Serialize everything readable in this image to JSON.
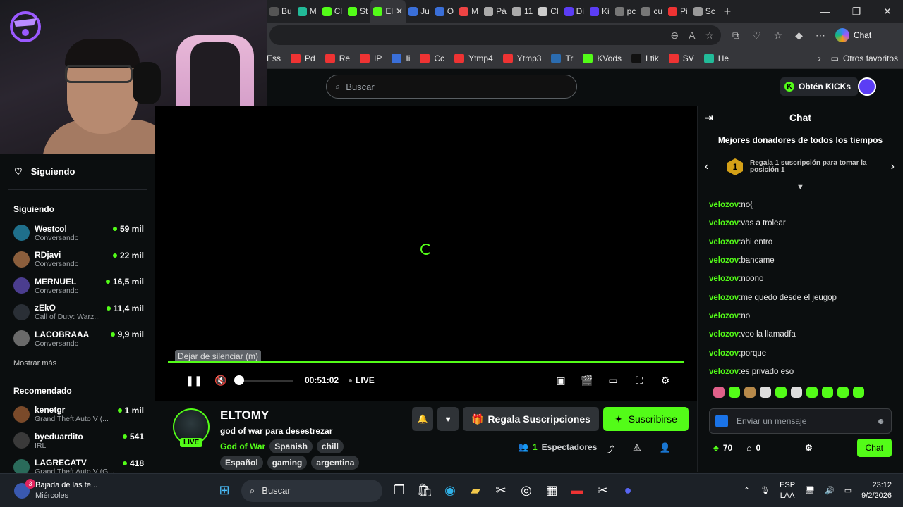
{
  "browser": {
    "tabs": [
      "Bu",
      "M",
      "Cl",
      "St",
      "El",
      "Ju",
      "O",
      "M",
      "Pá",
      "11",
      "Cl",
      "Di",
      "Ki",
      "pc",
      "cu",
      "Pi",
      "Sc"
    ],
    "active_tab_index": 4,
    "copilot_label": "Chat",
    "bookmarks": [
      "Pd",
      "Re",
      "IP",
      "Ii",
      "Cc",
      "Ytmp4",
      "Ytmp3",
      "Tr",
      "KVods",
      "Ltik",
      "SV",
      "He"
    ],
    "bookmark_first_partial": "Ess",
    "other_favorites": "Otros favoritos"
  },
  "site": {
    "search_placeholder": "Buscar",
    "kicks_button": "Obtén KICKs"
  },
  "sidebar": {
    "following_title": "Siguiendo",
    "following_header": "Siguiendo",
    "following": [
      {
        "name": "Westcol",
        "sub": "Conversando",
        "viewers": "59 mil",
        "color": "#1f6f8b"
      },
      {
        "name": "RDjavi",
        "sub": "Conversando",
        "viewers": "22 mil",
        "color": "#8b5e3c"
      },
      {
        "name": "MERNUEL",
        "sub": "Conversando",
        "viewers": "16,5 mil",
        "color": "#4b3d8f"
      },
      {
        "name": "zEkO",
        "sub": "Call of Duty: Warz...",
        "viewers": "11,4 mil",
        "color": "#2a2f36"
      },
      {
        "name": "LACOBRAAA",
        "sub": "Conversando",
        "viewers": "9,9 mil",
        "color": "#6a6a6a"
      }
    ],
    "show_more": "Mostrar más",
    "recommended_header": "Recomendado",
    "recommended": [
      {
        "name": "kenetgr",
        "sub": "Grand Theft Auto V (...",
        "viewers": "1 mil",
        "color": "#7a4a2a"
      },
      {
        "name": "byeduardito",
        "sub": "IRL",
        "viewers": "541",
        "color": "#3a3a3a"
      },
      {
        "name": "LAGRECATV",
        "sub": "Grand Theft Auto V (G...",
        "viewers": "418",
        "color": "#2a6a5a"
      }
    ]
  },
  "player": {
    "tooltip": "Dejar de silenciar (m)",
    "time": "00:51:02",
    "live_label": "LIVE"
  },
  "stream": {
    "streamer": "ELTOMY",
    "live_badge": "LIVE",
    "title": "god of war para desestrezar",
    "category": "God of War",
    "tags_row1": [
      "Spanish",
      "chill"
    ],
    "tags_row2": [
      "Español",
      "gaming",
      "argentina"
    ],
    "gift_label": "Regala Suscripciones",
    "subscribe_label": "Suscribirse",
    "viewers_count": "1",
    "viewers_label": "Espectadores"
  },
  "chat": {
    "title": "Chat",
    "donors_title": "Mejores donadores de todos los tiempos",
    "donor_rank": "1",
    "donor_text": "Regala 1 suscripción para tomar la posición 1",
    "messages": [
      {
        "user": "velozov",
        "text": "no{"
      },
      {
        "user": "velozov",
        "text": "vas a trolear"
      },
      {
        "user": "velozov",
        "text": "ahi entro"
      },
      {
        "user": "velozov",
        "text": "bancame"
      },
      {
        "user": "velozov",
        "text": "noono"
      },
      {
        "user": "velozov",
        "text": "me quedo desde el jeugop"
      },
      {
        "user": "velozov",
        "text": "no"
      },
      {
        "user": "velozov",
        "text": "veo la llamadfa"
      },
      {
        "user": "velozov",
        "text": "porque"
      },
      {
        "user": "velozov",
        "text": "es privado eso"
      }
    ],
    "input_placeholder": "Enviar un mensaje",
    "kicks_count": "70",
    "subs_count": "0",
    "send_button": "Chat"
  },
  "taskbar": {
    "notif_title": "Bajada de las te...",
    "notif_sub": "Miércoles",
    "notif_badge": "3",
    "search_label": "Buscar",
    "lang1": "ESP",
    "lang2": "LAA",
    "time": "23:12",
    "date": "9/2/2026"
  },
  "colors": {
    "accent": "#53fc18",
    "background": "#0b0e0f"
  }
}
